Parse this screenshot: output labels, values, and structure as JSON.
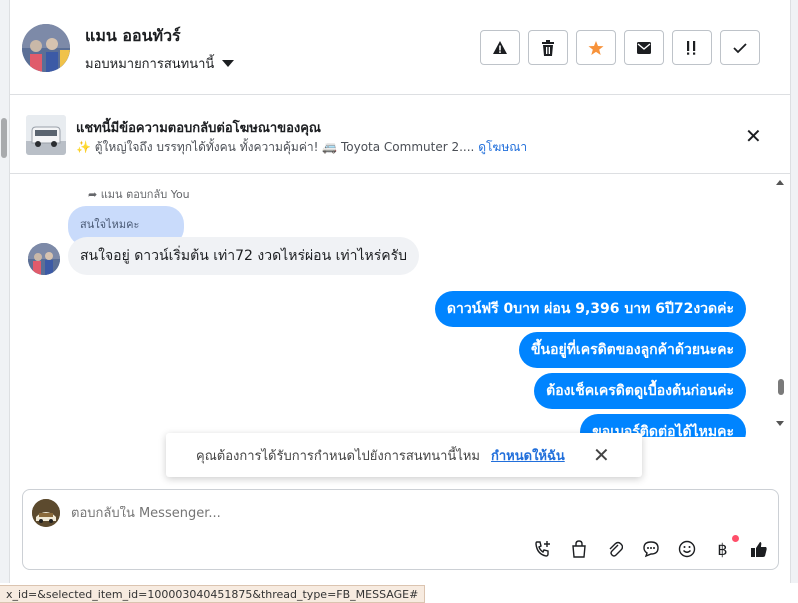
{
  "header": {
    "name": "แมน ออนทัวร์",
    "assign_label": "มอบหมายการสนทนานี้",
    "actions": [
      "warning-icon",
      "trash-icon",
      "star-icon",
      "mail-icon",
      "important-icon",
      "check-icon"
    ]
  },
  "ad": {
    "title": "แชทนี้มีข้อความตอบกลับต่อโฆษณาของคุณ",
    "subtitle": "✨ ตู้ใหญ่ใจถึง บรรทุกได้ทั้งคน ทั้งความคุ้มค่า! 🚐 Toyota Commuter 2....",
    "link": "ดูโฆษณา"
  },
  "chat": {
    "reply_indicator": "แมน ตอบกลับ You",
    "quoted_text": "สนใจไหมคะ",
    "incoming": "สนใจอยู่ ดาวน์เริ่มต้น  เท่า72 งวดไหร่ผ่อน เท่าไหร่ครับ",
    "outgoing": [
      "ดาวน์ฟรี 0บาท ผ่อน 9,396 บาท 6ปี72งวดค่ะ",
      "ขึ้นอยู่ที่เครดิตของลูกค้าด้วยนะคะ",
      "ต้องเช็คเครดิตดูเบื้องต้นก่อนค่ะ",
      "ขอเบอร์ติดต่อได้ไหมคะ"
    ]
  },
  "toast": {
    "text": "คุณต้องการได้รับการกำหนดไปยังการสนทนานี้ไหม",
    "link": "กำหนดให้ฉัน"
  },
  "composer": {
    "placeholder": "ตอบกลับใน Messenger...",
    "tools": [
      "phone-add-icon",
      "shopping-bag-icon",
      "attachment-icon",
      "saved-reply-icon",
      "emoji-icon",
      "baht-icon",
      "thumbs-up-icon"
    ]
  },
  "status_bar": {
    "url": "x_id=&selected_item_id=100003040451875&thread_type=FB_MESSAGE#"
  }
}
